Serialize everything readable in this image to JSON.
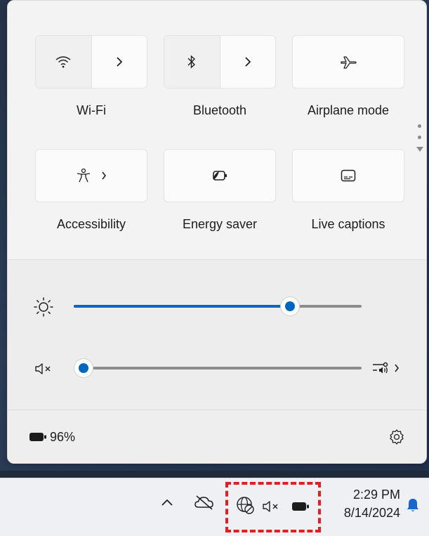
{
  "quick_settings": {
    "tiles": [
      {
        "label": "Wi-Fi",
        "icon": "wifi-icon",
        "has_chevron": true
      },
      {
        "label": "Bluetooth",
        "icon": "bluetooth-icon",
        "has_chevron": true
      },
      {
        "label": "Airplane mode",
        "icon": "airplane-icon",
        "has_chevron": false
      },
      {
        "label": "Accessibility",
        "icon": "accessibility-icon",
        "has_chevron": true
      },
      {
        "label": "Energy saver",
        "icon": "energy-saver-icon",
        "has_chevron": false
      },
      {
        "label": "Live captions",
        "icon": "live-captions-icon",
        "has_chevron": false
      }
    ],
    "brightness": {
      "icon": "brightness-icon",
      "value_fraction": 0.75
    },
    "volume": {
      "icon": "volume-muted-icon",
      "value_fraction": 0.0,
      "output_icon": "audio-output-icon"
    },
    "battery": {
      "icon": "battery-icon",
      "text": "96%"
    },
    "settings_icon": "gear-icon"
  },
  "taskbar": {
    "overflow_icon": "chevron-up-icon",
    "cloud_icon": "onedrive-offline-icon",
    "network_icon": "network-disconnected-icon",
    "volume_icon": "volume-muted-icon",
    "battery_icon": "battery-icon",
    "time": "2:29 PM",
    "date": "8/14/2024",
    "notifications_icon": "bell-icon"
  },
  "colors": {
    "accent": "#0067c0",
    "highlight_box": "#e02020"
  }
}
